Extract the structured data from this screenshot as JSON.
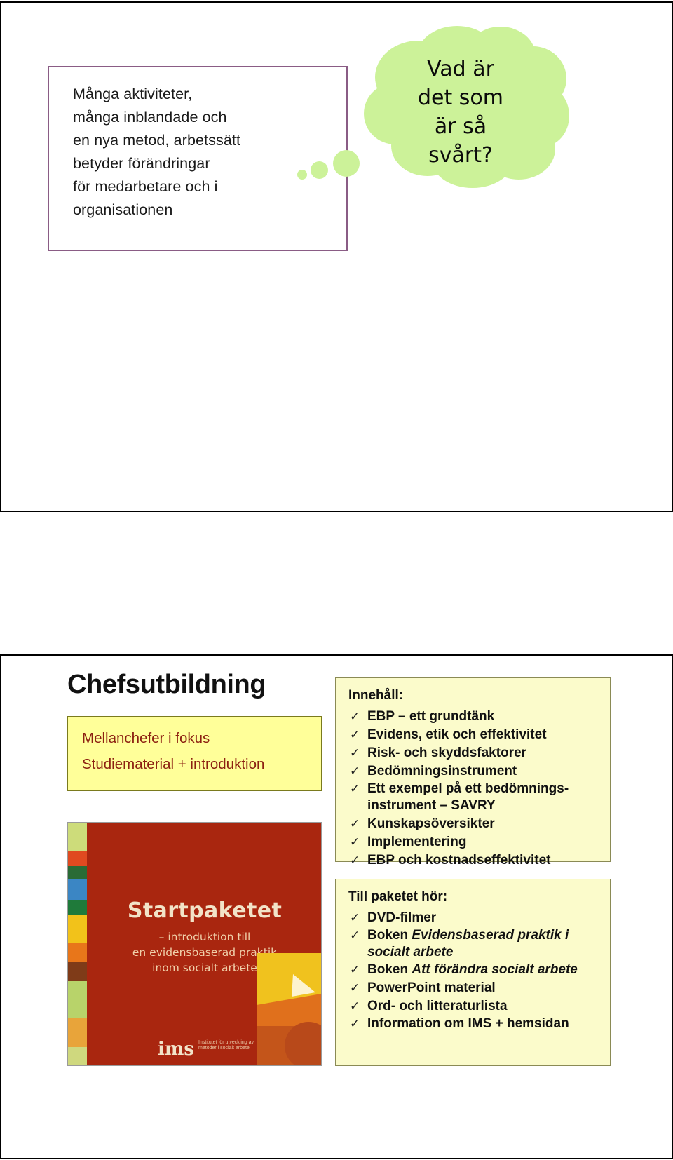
{
  "slide1": {
    "message_box": {
      "text": "Många aktiviteter,\nmånga inblandade och\nen nya metod, arbetssätt\nbetyder förändringar\nför medarbetare och i\norganisationen",
      "border_color": "#8a5c85"
    },
    "thought_bubble": {
      "text": "Vad är\ndet som\när så\nsvårt?",
      "fill_color": "#ccf299"
    }
  },
  "slide2": {
    "title": "Chefsutbildning",
    "subtitle_box": {
      "line1": "Mellanchefer i fokus",
      "line2": "Studiematerial + introduktion",
      "background": "#ffff99",
      "text_color": "#8c2011"
    },
    "book_cover": {
      "title": "Startpaketet",
      "subtitle": "– introduktion till\nen evidensbaserad praktik\ninom socialt arbete",
      "logo": "ims",
      "background": "#a9260f"
    },
    "innehall": {
      "heading": "Innehåll:",
      "items": [
        {
          "text": "EBP – ett grundtänk"
        },
        {
          "text": "Evidens, etik och effektivitet"
        },
        {
          "text": "Risk- och skyddsfaktorer"
        },
        {
          "text": "Bedömningsinstrument"
        },
        {
          "text": "Ett exempel på ett bedömnings-instrument – SAVRY"
        },
        {
          "text": "Kunskapsöversikter"
        },
        {
          "text": "Implementering"
        },
        {
          "text": "EBP och kostnadseffektivitet"
        }
      ]
    },
    "paketet": {
      "heading": "Till paketet hör:",
      "items": [
        {
          "prefix": "DVD-filmer",
          "italic": "",
          "suffix": ""
        },
        {
          "prefix": "Boken ",
          "italic": "Evidensbaserad praktik i socialt arbete",
          "suffix": ""
        },
        {
          "prefix": "Boken ",
          "italic": "Att förändra socialt arbete",
          "suffix": ""
        },
        {
          "prefix": "PowerPoint material",
          "italic": "",
          "suffix": ""
        },
        {
          "prefix": "Ord- och litteraturlista",
          "italic": "",
          "suffix": ""
        },
        {
          "prefix": "Information om IMS + hemsidan",
          "italic": "",
          "suffix": ""
        }
      ]
    },
    "check_glyph": "✓"
  }
}
